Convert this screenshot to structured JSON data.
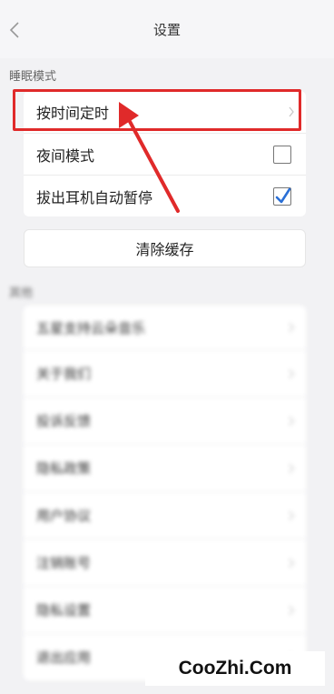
{
  "header": {
    "title": "设置"
  },
  "sleep_section": {
    "label": "睡眠模式",
    "items": [
      {
        "label": "按时间定时",
        "type": "chevron"
      },
      {
        "label": "夜间模式",
        "type": "checkbox",
        "checked": false
      },
      {
        "label": "拔出耳机自动暂停",
        "type": "checkbox",
        "checked": true
      }
    ]
  },
  "clear_cache_label": "清除缓存",
  "other_section": {
    "label": "其他",
    "items": [
      {
        "label": "五星支持云朵音乐"
      },
      {
        "label": "关于我们"
      },
      {
        "label": "投诉反馈"
      },
      {
        "label": "隐私政策"
      },
      {
        "label": "用户协议"
      },
      {
        "label": "注销账号"
      },
      {
        "label": "隐私设置"
      },
      {
        "label": "退出应用"
      }
    ]
  },
  "annotation": {
    "highlight_color": "#e02a2a",
    "arrow_color": "#e02a2a"
  },
  "watermark": "CooZhi.Com",
  "colors": {
    "checkbox_check": "#2a6fd6"
  }
}
